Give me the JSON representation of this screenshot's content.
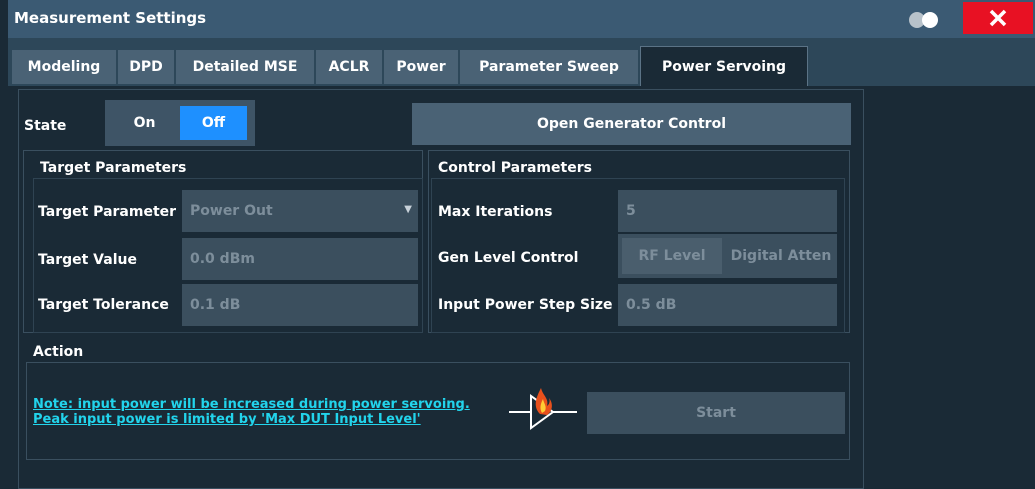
{
  "window": {
    "title": "Measurement Settings",
    "close_label": "✕"
  },
  "tabs": [
    {
      "label": "Modeling"
    },
    {
      "label": "DPD"
    },
    {
      "label": "Detailed MSE"
    },
    {
      "label": "ACLR"
    },
    {
      "label": "Power"
    },
    {
      "label": "Parameter Sweep"
    },
    {
      "label": "Power Servoing",
      "active": true
    }
  ],
  "state": {
    "label": "State",
    "on_label": "On",
    "off_label": "Off",
    "selected": "Off"
  },
  "open_generator_label": "Open Generator Control",
  "target_parameters": {
    "title": "Target Parameters",
    "parameter_label": "Target Parameter",
    "parameter_value": "Power Out",
    "value_label": "Target Value",
    "value_value": "0.0 dBm",
    "tolerance_label": "Target Tolerance",
    "tolerance_value": "0.1 dB"
  },
  "control_parameters": {
    "title": "Control Parameters",
    "max_iter_label": "Max Iterations",
    "max_iter_value": "5",
    "gen_level_label": "Gen Level Control",
    "gen_level_options": [
      "RF Level",
      "Digital Atten"
    ],
    "step_label": "Input Power Step Size",
    "step_value": "0.5 dB"
  },
  "action": {
    "title": "Action",
    "note_line1": "Note: input power will be increased during power servoing.",
    "note_line2": "Peak input power is limited by 'Max DUT Input Level'",
    "start_label": "Start"
  },
  "colors": {
    "accent": "#1e90ff",
    "note": "#22d4ec",
    "close": "#e81123"
  }
}
